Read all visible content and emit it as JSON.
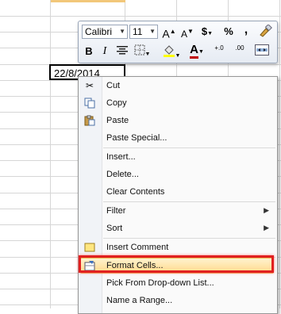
{
  "cell": {
    "value": "22/8/2014"
  },
  "minibar": {
    "font_name": "Calibri",
    "font_size": "11",
    "grow_font": "A",
    "shrink_font": "A",
    "currency": "$",
    "percent": "%",
    "comma": ",",
    "bold": "B",
    "italic": "I",
    "font_color_glyph": "A",
    "inc_decimal": "+.0",
    "dec_decimal": ".00"
  },
  "menu": {
    "cut": "Cut",
    "copy": "Copy",
    "paste": "Paste",
    "paste_special": "Paste Special...",
    "insert": "Insert...",
    "delete": "Delete...",
    "clear": "Clear Contents",
    "filter": "Filter",
    "sort": "Sort",
    "insert_comment": "Insert Comment",
    "format_cells": "Format Cells...",
    "pick_list": "Pick From Drop-down List...",
    "name_range": "Name a Range..."
  },
  "colors": {
    "highlight": "#ffd98a",
    "annotation": "#e02020",
    "font_color": "#c00000",
    "fill_color": "#ffff00"
  }
}
